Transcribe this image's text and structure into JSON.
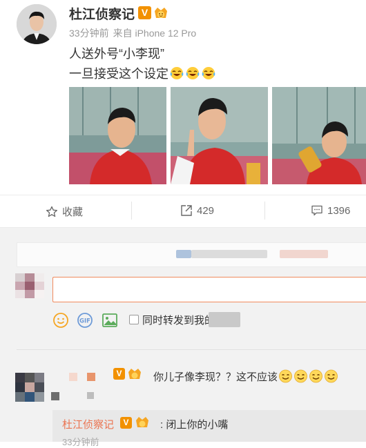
{
  "post": {
    "author": "杜江侦察记",
    "verified_badge": "V",
    "time": "33分钟前",
    "source": "来自 iPhone 12 Pro",
    "text_line1": "人送外号“小李现”",
    "text_line2": "一旦接受这个设定",
    "line2_emojis": [
      "laugh-cry-emoji",
      "laugh-cry-emoji",
      "laugh-cry-emoji"
    ],
    "photos": [
      "boy-looking-up-photo",
      "boy-pointing-up-photo",
      "boy-drinking-photo"
    ]
  },
  "actions": {
    "favorite_label": "收藏",
    "repost_count": "429",
    "comment_count": "1396"
  },
  "composer": {
    "repost_checkbox_label": "同时转发到我的",
    "repost_checked": false,
    "icons": [
      "emoji-icon",
      "gif-icon",
      "image-icon"
    ]
  },
  "comment": {
    "verified_badge": "V",
    "text": "你儿子像李现？？这不应该",
    "emojis": [
      "smile-emoji",
      "smile-emoji",
      "smile-emoji",
      "smile-emoji"
    ],
    "reply": {
      "author": "杜江侦察记",
      "verified_badge": "V",
      "separator": ":",
      "text": "闭上你的小嘴",
      "time": "33分钟前"
    }
  },
  "colors": {
    "badge_orange": "#f29100",
    "link_orange": "#eb7350",
    "input_border": "#f08a5d",
    "comment_bg": "#f2f2f2"
  }
}
